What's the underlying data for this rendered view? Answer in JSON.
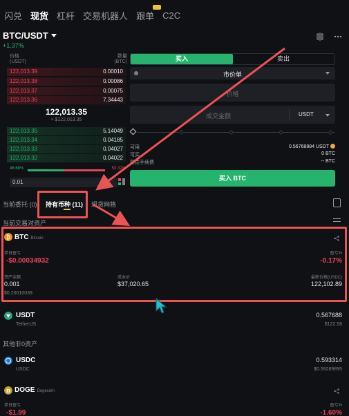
{
  "nav": {
    "items": [
      "闪兑",
      "现货",
      "杠杆",
      "交易机器人",
      "跟单",
      "C2C"
    ],
    "active": "现货"
  },
  "pair": {
    "name": "BTC/USDT",
    "change": "+1.37%"
  },
  "orderbook": {
    "header_price": "价格",
    "header_price_unit": "(USDT)",
    "header_qty": "数量",
    "header_qty_unit": "(BTC)",
    "asks": [
      {
        "price": "122,013.39",
        "qty": "0.00010"
      },
      {
        "price": "122,013.38",
        "qty": "0.00086"
      },
      {
        "price": "122,013.37",
        "qty": "0.00075"
      },
      {
        "price": "122,013.36",
        "qty": "7.34443"
      }
    ],
    "last_price": "122,013.35",
    "last_price_fiat": "≈ $122,013.35",
    "bids": [
      {
        "price": "122,013.35",
        "qty": "5.14049"
      },
      {
        "price": "122,013.34",
        "qty": "0.04185"
      },
      {
        "price": "122,013.33",
        "qty": "0.04027"
      },
      {
        "price": "122,013.32",
        "qty": "0.04022"
      }
    ],
    "buy_ratio_label": "46.68%",
    "sell_ratio_label": "53.32%",
    "buy_ratio": 0.4668,
    "depth": "0.01"
  },
  "trade": {
    "buy_tab": "买入",
    "sell_tab": "卖出",
    "order_type": "市价单",
    "price_placeholder": "价格",
    "amount_placeholder": "成交金额",
    "amount_unit": "USDT",
    "available_label": "可用",
    "available_value": "0.56768884 USDT",
    "can_buy_label": "可买",
    "can_buy_value": "0 BTC",
    "fee_label": "预估手续费",
    "fee_value": "-- BTC",
    "buy_button": "买入 BTC"
  },
  "tabs": {
    "orders": "当前委托 (0)",
    "holdings": "持有币种 (11)",
    "grid": "现货网格"
  },
  "section_current": "当前交易对资产",
  "btc": {
    "symbol": "BTC",
    "name": "Bitcoin",
    "pnl_today_label": "单日盈亏",
    "pnl_today": "-$0.00034932",
    "pnl_pct_label": "盈亏%",
    "pnl_pct": "-0.17%",
    "balance_label": "资产余额",
    "balance": "0.001",
    "balance_fiat": "$0.20010039",
    "cost_label": "成本价",
    "cost": "$37,020.65",
    "latest_label": "最新价格(USDC)",
    "latest": "122,102.89"
  },
  "usdt": {
    "symbol": "USDT",
    "name": "TetherUS",
    "amount": "0.567688",
    "fiat": "$122.58"
  },
  "section_other": "其他非0资产",
  "usdc": {
    "symbol": "USDC",
    "name": "USDC",
    "amount": "0.593314",
    "fiat": "$0.59289895"
  },
  "doge": {
    "symbol": "DOGE",
    "name": "Dogecoin",
    "pnl_today_label": "单日盈亏",
    "pnl_today": "-$1.99",
    "pnl_pct_label": "盈亏%",
    "pnl_pct": "-1.60%"
  },
  "colors": {
    "buy": "#25b36e",
    "sell": "#e0475a",
    "accent": "#f0c33c",
    "annotation": "#ea5455"
  }
}
